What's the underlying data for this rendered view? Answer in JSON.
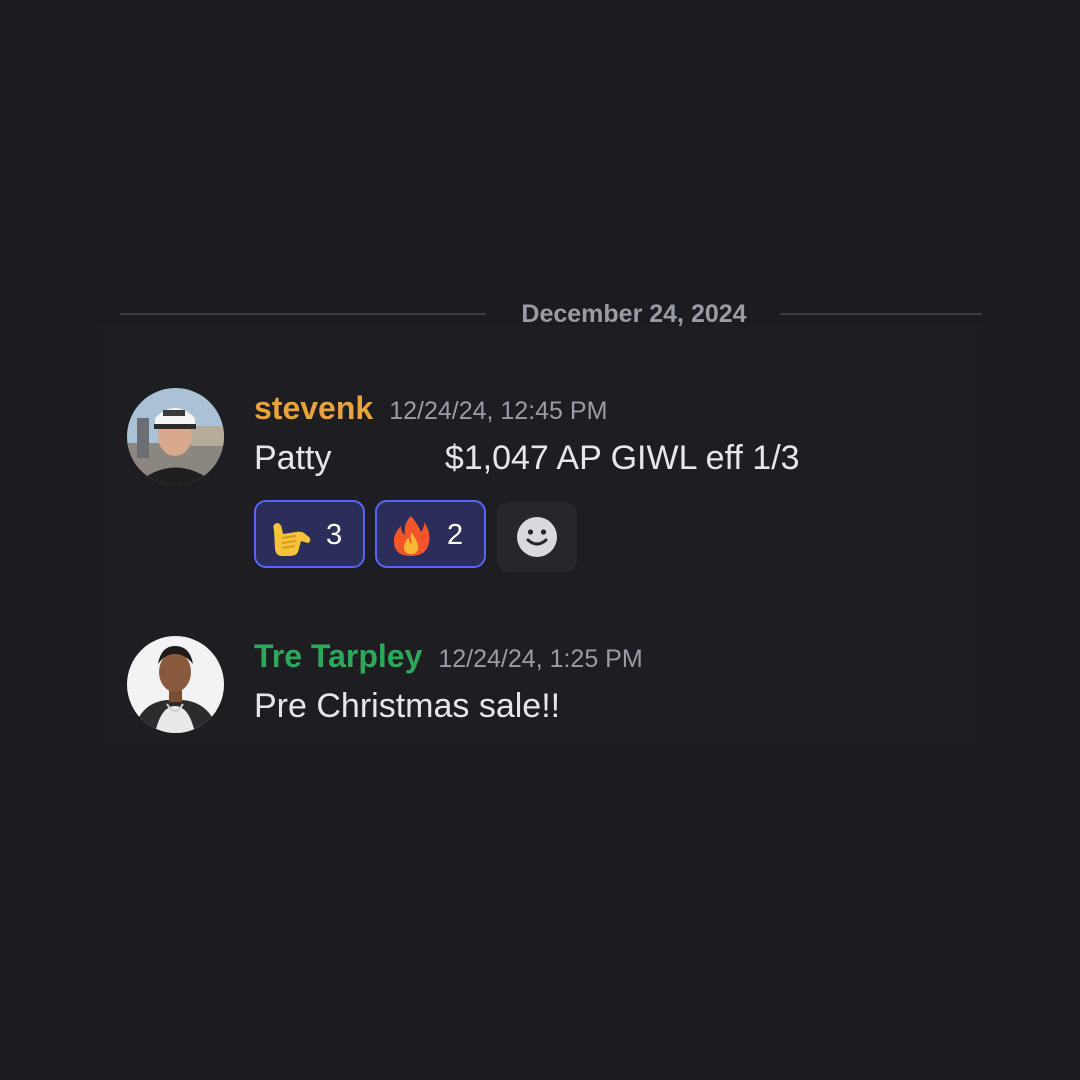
{
  "divider": {
    "date": "December 24, 2024"
  },
  "messages": [
    {
      "author": "stevenk",
      "author_color": "#e8a33a",
      "timestamp": "12/24/24, 12:45 PM",
      "content": "Patty            $1,047 AP GIWL eff 1/3",
      "reactions": [
        {
          "emoji_icon": "call-me-hand-icon",
          "count": "3",
          "selected": true
        },
        {
          "emoji_icon": "fire-icon",
          "count": "2",
          "selected": true
        }
      ],
      "add_reaction_icon": "smiley-face-icon"
    },
    {
      "author": "Tre Tarpley",
      "author_color": "#2da85b",
      "timestamp": "12/24/24, 1:25 PM",
      "content": "Pre Christmas sale!!"
    }
  ],
  "colors": {
    "background": "#1c1c20",
    "muted_text": "#9a9ca5",
    "message_text": "#e6e7ea",
    "reaction_bg": "#2b2d5b",
    "reaction_border": "#5865f2"
  }
}
